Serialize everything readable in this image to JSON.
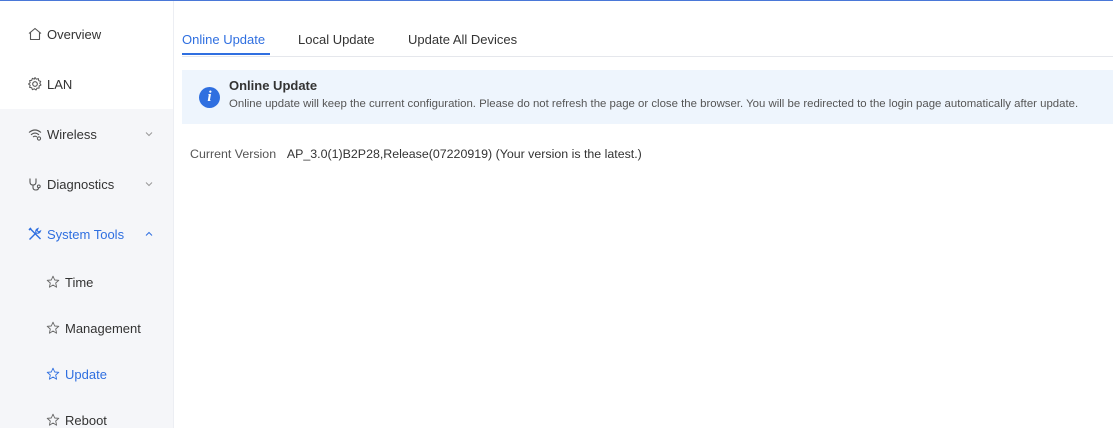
{
  "sidebar": {
    "items": [
      {
        "label": "Overview",
        "icon": "home-icon"
      },
      {
        "label": "LAN",
        "icon": "gear-icon"
      },
      {
        "label": "Wireless",
        "icon": "wifi-icon"
      },
      {
        "label": "Diagnostics",
        "icon": "stethoscope-icon"
      },
      {
        "label": "System Tools",
        "icon": "tools-icon"
      }
    ],
    "subitems": [
      {
        "label": "Time",
        "icon": "star-icon"
      },
      {
        "label": "Management",
        "icon": "star-icon"
      },
      {
        "label": "Update",
        "icon": "star-icon"
      },
      {
        "label": "Reboot",
        "icon": "star-icon"
      }
    ]
  },
  "tabs": [
    {
      "label": "Online Update"
    },
    {
      "label": "Local Update"
    },
    {
      "label": "Update All Devices"
    }
  ],
  "notice": {
    "title": "Online Update",
    "text": "Online update will keep the current configuration. Please do not refresh the page or close the browser. You will be redirected to the login page automatically after update."
  },
  "version": {
    "label": "Current Version",
    "value": "AP_3.0(1)B2P28,Release(07220919) (Your version is the latest.)"
  },
  "colors": {
    "accent": "#2f6fe0",
    "notice_bg": "#eef5fd",
    "sidebar_shade": "#f5f6f9"
  }
}
